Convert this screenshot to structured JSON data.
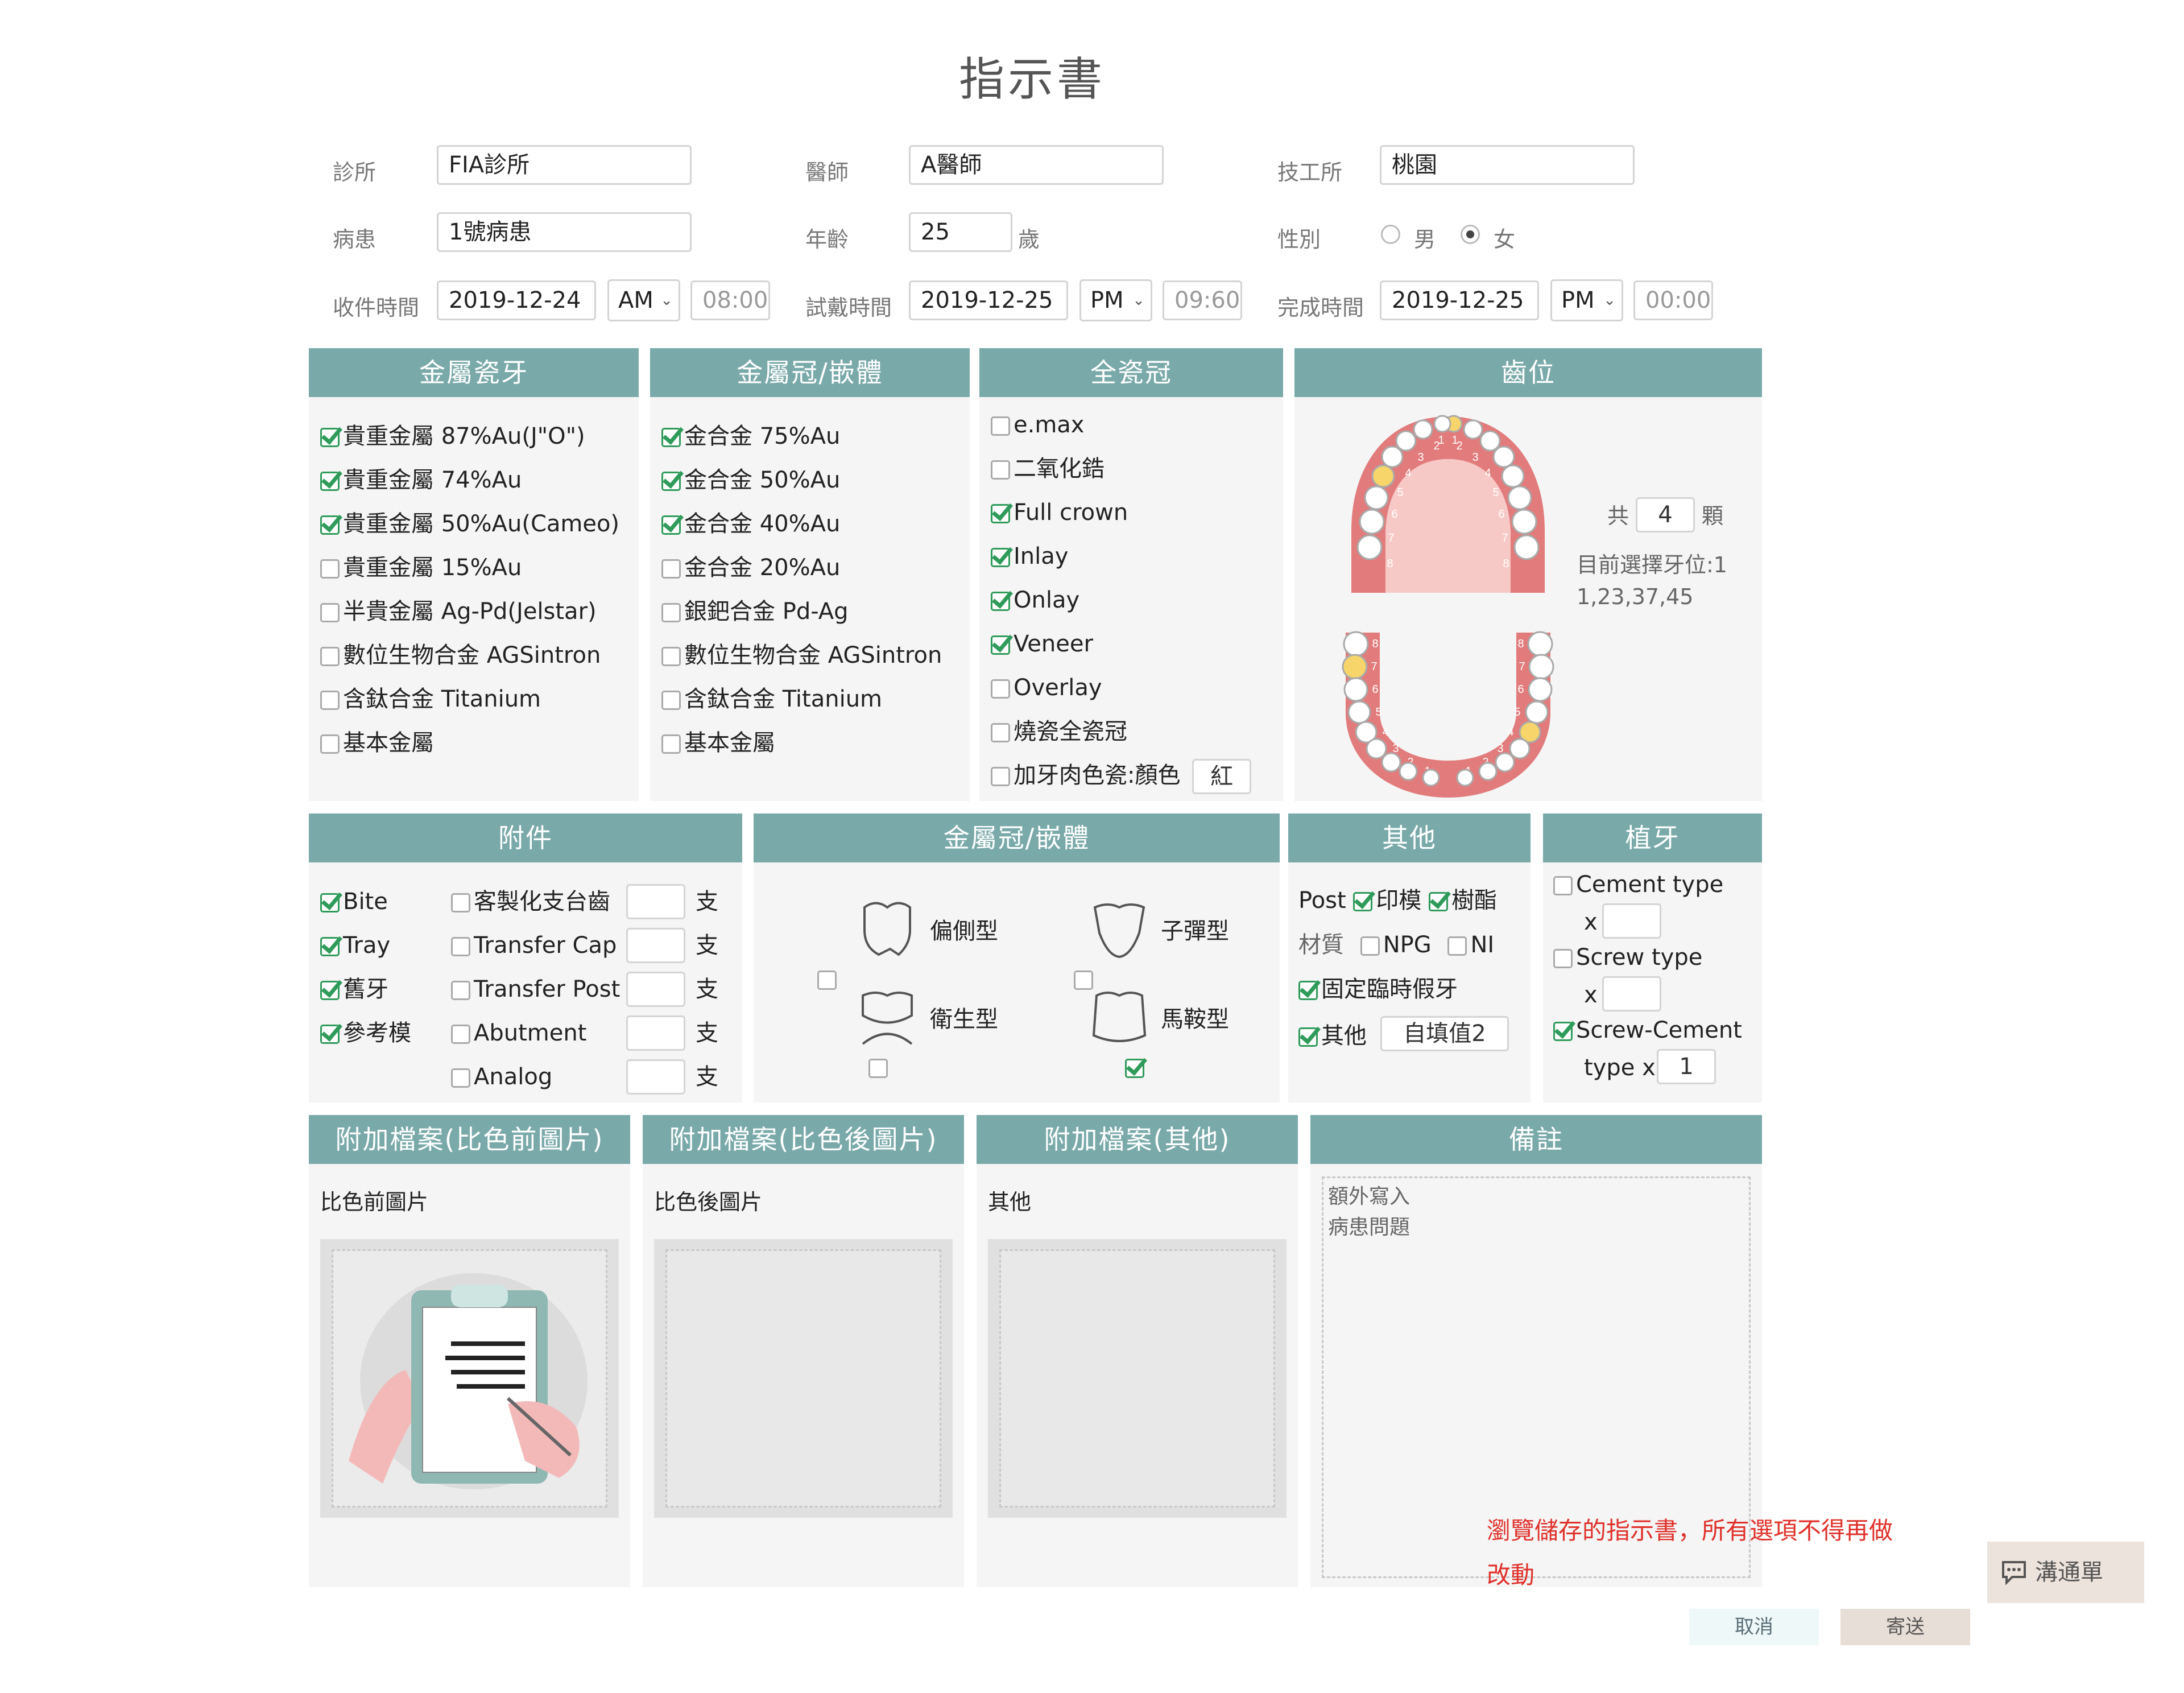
{
  "page_title": "指示書",
  "form": {
    "clinic_label": "診所",
    "clinic_value": "FIA診所",
    "doctor_label": "醫師",
    "doctor_value": "A醫師",
    "lab_label": "技工所",
    "lab_value": "桃園",
    "patient_label": "病患",
    "patient_value": "1號病患",
    "age_label": "年齡",
    "age_value": "25",
    "age_unit": "歲",
    "gender_label": "性別",
    "gender_male": "男",
    "gender_female": "女",
    "gender_selected": "女",
    "receive_label": "收件時間",
    "receive_date": "2019-12-24",
    "receive_ampm": "AM",
    "receive_time": "08:00",
    "tryin_label": "試戴時間",
    "tryin_date": "2019-12-25",
    "tryin_ampm": "PM",
    "tryin_time": "09:60",
    "finish_label": "完成時間",
    "finish_date": "2019-12-25",
    "finish_ampm": "PM",
    "finish_time": "00:00"
  },
  "pfm": {
    "title": "金屬瓷牙",
    "items": [
      {
        "label": "貴重金屬 87%Au(J\"O\")",
        "checked": true
      },
      {
        "label": "貴重金屬 74%Au",
        "checked": true
      },
      {
        "label": "貴重金屬 50%Au(Cameo)",
        "checked": true
      },
      {
        "label": "貴重金屬 15%Au",
        "checked": false
      },
      {
        "label": "半貴金屬 Ag-Pd(Jelstar)",
        "checked": false
      },
      {
        "label": "數位生物合金 AGSintron",
        "checked": false
      },
      {
        "label": "含鈦合金 Titanium",
        "checked": false
      },
      {
        "label": "基本金屬",
        "checked": false
      }
    ]
  },
  "metal_crown": {
    "title": "金屬冠/嵌體",
    "items": [
      {
        "label": "金合金 75%Au",
        "checked": true
      },
      {
        "label": "金合金 50%Au",
        "checked": true
      },
      {
        "label": "金合金 40%Au",
        "checked": true
      },
      {
        "label": "金合金 20%Au",
        "checked": false
      },
      {
        "label": "銀鈀合金 Pd-Ag",
        "checked": false
      },
      {
        "label": "數位生物合金 AGSintron",
        "checked": false
      },
      {
        "label": "含鈦合金 Titanium",
        "checked": false
      },
      {
        "label": "基本金屬",
        "checked": false
      }
    ]
  },
  "all_ceramic": {
    "title": "全瓷冠",
    "items": [
      {
        "label": "e.max",
        "checked": false
      },
      {
        "label": "二氧化鋯",
        "checked": false
      },
      {
        "label": "Full crown",
        "checked": true
      },
      {
        "label": "Inlay",
        "checked": true
      },
      {
        "label": "Onlay",
        "checked": true
      },
      {
        "label": "Veneer",
        "checked": true
      },
      {
        "label": "Overlay",
        "checked": false
      },
      {
        "label": "燒瓷全瓷冠",
        "checked": false
      },
      {
        "label": "加牙肉色瓷:顏色",
        "checked": false
      }
    ],
    "color_value": "紅"
  },
  "tooth_position": {
    "title": "齒位",
    "total_prefix": "共",
    "total_count": "4",
    "total_suffix": "顆",
    "selected_label": "目前選擇牙位:1",
    "selected_values": "1,23,37,45",
    "upper_numbers": [
      "1",
      "2",
      "3",
      "4",
      "5",
      "6",
      "7",
      "8",
      "1",
      "2",
      "3",
      "4",
      "5",
      "6",
      "7",
      "8"
    ],
    "lower_numbers": [
      "8",
      "7",
      "6",
      "5",
      "4",
      "3",
      "2",
      "1",
      "8",
      "7",
      "6",
      "5",
      "4",
      "3",
      "2",
      "1"
    ]
  },
  "attachments": {
    "title": "附件",
    "left_items": [
      {
        "label": "Bite",
        "checked": true
      },
      {
        "label": "Tray",
        "checked": true
      },
      {
        "label": "舊牙",
        "checked": true
      },
      {
        "label": "參考模",
        "checked": true
      }
    ],
    "right_items": [
      {
        "label": "客製化支台齒",
        "checked": false,
        "qty": "",
        "unit": "支"
      },
      {
        "label": "Transfer Cap",
        "checked": false,
        "qty": "",
        "unit": "支"
      },
      {
        "label": "Transfer Post",
        "checked": false,
        "qty": "",
        "unit": "支"
      },
      {
        "label": "Abutment",
        "checked": false,
        "qty": "",
        "unit": "支"
      },
      {
        "label": "Analog",
        "checked": false,
        "qty": "",
        "unit": "支"
      }
    ]
  },
  "pontic": {
    "title": "金屬冠/嵌體",
    "items": [
      {
        "label": "偏側型",
        "checked": false
      },
      {
        "label": "子彈型",
        "checked": false
      },
      {
        "label": "衛生型",
        "checked": false
      },
      {
        "label": "馬鞍型",
        "checked": true
      }
    ]
  },
  "others": {
    "title": "其他",
    "post_label": "Post",
    "post_impression": {
      "label": "印模",
      "checked": true
    },
    "post_resin": {
      "label": "樹酯",
      "checked": true
    },
    "material_label": "材質",
    "material_npg": {
      "label": "NPG",
      "checked": false
    },
    "material_ni": {
      "label": "NI",
      "checked": false
    },
    "temp_crown": {
      "label": "固定臨時假牙",
      "checked": true
    },
    "other": {
      "label": "其他",
      "checked": true
    },
    "other_value": "自填值2"
  },
  "implant": {
    "title": "植牙",
    "cement": {
      "label": "Cement type",
      "checked": false,
      "x_label": "x",
      "qty": ""
    },
    "screw": {
      "label": "Screw type",
      "checked": false,
      "x_label": "x",
      "qty": ""
    },
    "screw_cement": {
      "label": "Screw-Cement",
      "checked": true,
      "type_label": "type x",
      "qty": "1"
    }
  },
  "files": {
    "before": {
      "title": "附加檔案(比色前圖片)",
      "label": "比色前圖片"
    },
    "after": {
      "title": "附加檔案(比色後圖片)",
      "label": "比色後圖片"
    },
    "other": {
      "title": "附加檔案(其他)",
      "label": "其他"
    }
  },
  "remarks": {
    "title": "備註",
    "text_line1": "額外寫入",
    "text_line2": "病患問題"
  },
  "warning": {
    "line1": "瀏覽儲存的指示書，所有選項不得再做",
    "line2": "改動",
    "color": "#e0312b"
  },
  "chat_button": "溝通單",
  "cancel_button": "取消",
  "send_button": "寄送",
  "colors": {
    "header": "#7aa9aa",
    "panel": "#f5f5f5",
    "check": "#2f9b5a"
  }
}
